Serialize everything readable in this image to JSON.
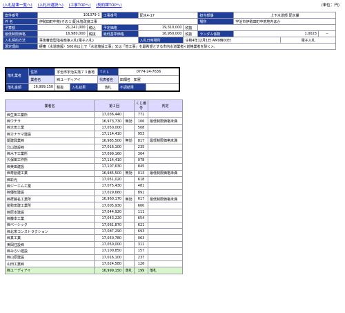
{
  "nav": {
    "links": [
      "(入札結果一覧へ)",
      "(入札日選択へ)",
      "(工事TOPへ)",
      "(契約課TOPへ)"
    ],
    "unit": "(単位：円)"
  },
  "info": {
    "r1": {
      "l1": "案件番号",
      "v1": "101379-1",
      "l2": "工事番号",
      "v2": "配水4-17",
      "l3": "担当部課",
      "v3": "上下水道部 配水課"
    },
    "r2": {
      "l1": "件 名",
      "v1": "伊勢田町中荒(その１)配水管改良工事",
      "l2": "場所",
      "v2": "宇治市伊勢田町中荒地内ほか"
    },
    "r3": {
      "l1": "予算額",
      "v1": "21,241,000",
      "t1": "税込",
      "l2": "予定価格",
      "v2": "19,310,000",
      "t2": "税抜"
    },
    "r4": {
      "l1": "最低制限価格",
      "v1": "16,980,000",
      "t1": "税抜",
      "l2": "最低基準価格",
      "v2": "16,950,000",
      "t2": "税抜",
      "l3": "ランダム係数",
      "v3": "1.0023",
      "v4": "--"
    },
    "r5": {
      "l1": "入札契約方法",
      "v1": "事後審査型指名競争入札(電子入札)",
      "l2": "入札日時場所",
      "v2": "令和4年12月1日 AM9時00分",
      "v3": "電子入札"
    },
    "r6": {
      "l1": "選定理由",
      "v1": "経審（水道施設）500点以上で「水道施設工事」又は「管工事」を最希望とする市内水道業者<前格業者を除く>。"
    }
  },
  "winner": {
    "addr_label": "住所",
    "addr": "宇治市宇治矢落７３番地",
    "tel_label": "ＴＥＬ",
    "tel": "0774-24-7636",
    "corp_label": "業者名",
    "corp": "㈱ユーディアイ",
    "rep_label": "代表者名",
    "rep": "田畑名　知憲",
    "row_label": "落札業者",
    "amt_label": "落札金額",
    "amount": "16,999,150",
    "tax": "税抜",
    "res_label": "入札結果",
    "result": "落札",
    "note_label": "不調結果"
  },
  "table": {
    "headers": [
      "業者名",
      "第１回",
      "くじ番号",
      "判定"
    ],
    "rows": [
      {
        "name": "㈱生田工業所",
        "bid": "17,036,440",
        "tag": "",
        "kuji": "771",
        "judge": ""
      },
      {
        "name": "㈱ウチラ",
        "bid": "16,973,730",
        "tag": "無効",
        "kuji": "106",
        "judge": "最低制限価格未満"
      },
      {
        "name": "㈱大田工業",
        "bid": "17,050,000",
        "tag": "",
        "kuji": "508",
        "judge": ""
      },
      {
        "name": "㈱カナヤマ建設",
        "bid": "17,114,410",
        "tag": "",
        "kuji": "953",
        "judge": ""
      },
      {
        "name": "関建興業㈱",
        "bid": "16,985,500",
        "tag": "無効",
        "kuji": "817",
        "judge": "最低制限価格未満"
      },
      {
        "name": "北山建設㈱",
        "bid": "17,016,100",
        "tag": "",
        "kuji": "235",
        "judge": ""
      },
      {
        "name": "㈱木下工業所",
        "bid": "17,099,160",
        "tag": "",
        "kuji": "304",
        "judge": ""
      },
      {
        "name": "久保田工作所",
        "bid": "17,114,410",
        "tag": "",
        "kuji": "078",
        "judge": ""
      },
      {
        "name": "㈱美田建設",
        "bid": "17,107,630",
        "tag": "",
        "kuji": "845",
        "judge": ""
      },
      {
        "name": "㈱寿創建工業",
        "bid": "16,985,500",
        "tag": "無効",
        "kuji": "013",
        "judge": "最低制限価格未満"
      },
      {
        "name": "㈱彩光",
        "bid": "17,051,020",
        "tag": "",
        "kuji": "618",
        "judge": ""
      },
      {
        "name": "㈱ジーエム工業",
        "bid": "17,075,430",
        "tag": "",
        "kuji": "481",
        "judge": ""
      },
      {
        "name": "㈱優知建設",
        "bid": "17,029,660",
        "tag": "",
        "kuji": "891",
        "judge": ""
      },
      {
        "name": "㈱拝藤名工業所",
        "bid": "16,960,170",
        "tag": "無効",
        "kuji": "617",
        "judge": "最低制限価格未満"
      },
      {
        "name": "能勢田建工業所",
        "bid": "17,005,930",
        "tag": "",
        "kuji": "660",
        "judge": ""
      },
      {
        "name": "㈱原本建設",
        "bid": "17,044,920",
        "tag": "",
        "kuji": "111",
        "judge": ""
      },
      {
        "name": "㈱藤本工業",
        "bid": "17,043,220",
        "tag": "",
        "kuji": "654",
        "judge": ""
      },
      {
        "name": "㈱ベーシック",
        "bid": "17,061,870",
        "tag": "",
        "kuji": "621",
        "judge": ""
      },
      {
        "name": "㈱北栄コンストラクション",
        "bid": "17,087,290",
        "tag": "",
        "kuji": "693",
        "judge": ""
      },
      {
        "name": "㈱真工業",
        "bid": "17,050,780",
        "tag": "",
        "kuji": "063",
        "judge": ""
      },
      {
        "name": "美岡住設㈱",
        "bid": "17,050,000",
        "tag": "",
        "kuji": "311",
        "judge": ""
      },
      {
        "name": "㈱みらい建設",
        "bid": "17,100,850",
        "tag": "",
        "kuji": "157",
        "judge": ""
      },
      {
        "name": "㈱山原建設",
        "bid": "17,016,100",
        "tag": "",
        "kuji": "237",
        "judge": ""
      },
      {
        "name": "山田工業㈱",
        "bid": "17,024,580",
        "tag": "",
        "kuji": "126",
        "judge": ""
      },
      {
        "name": "㈱ユーディアイ",
        "bid": "16,999,150",
        "tag": "落札",
        "kuji": "199",
        "judge": "落札",
        "win": true
      }
    ]
  }
}
